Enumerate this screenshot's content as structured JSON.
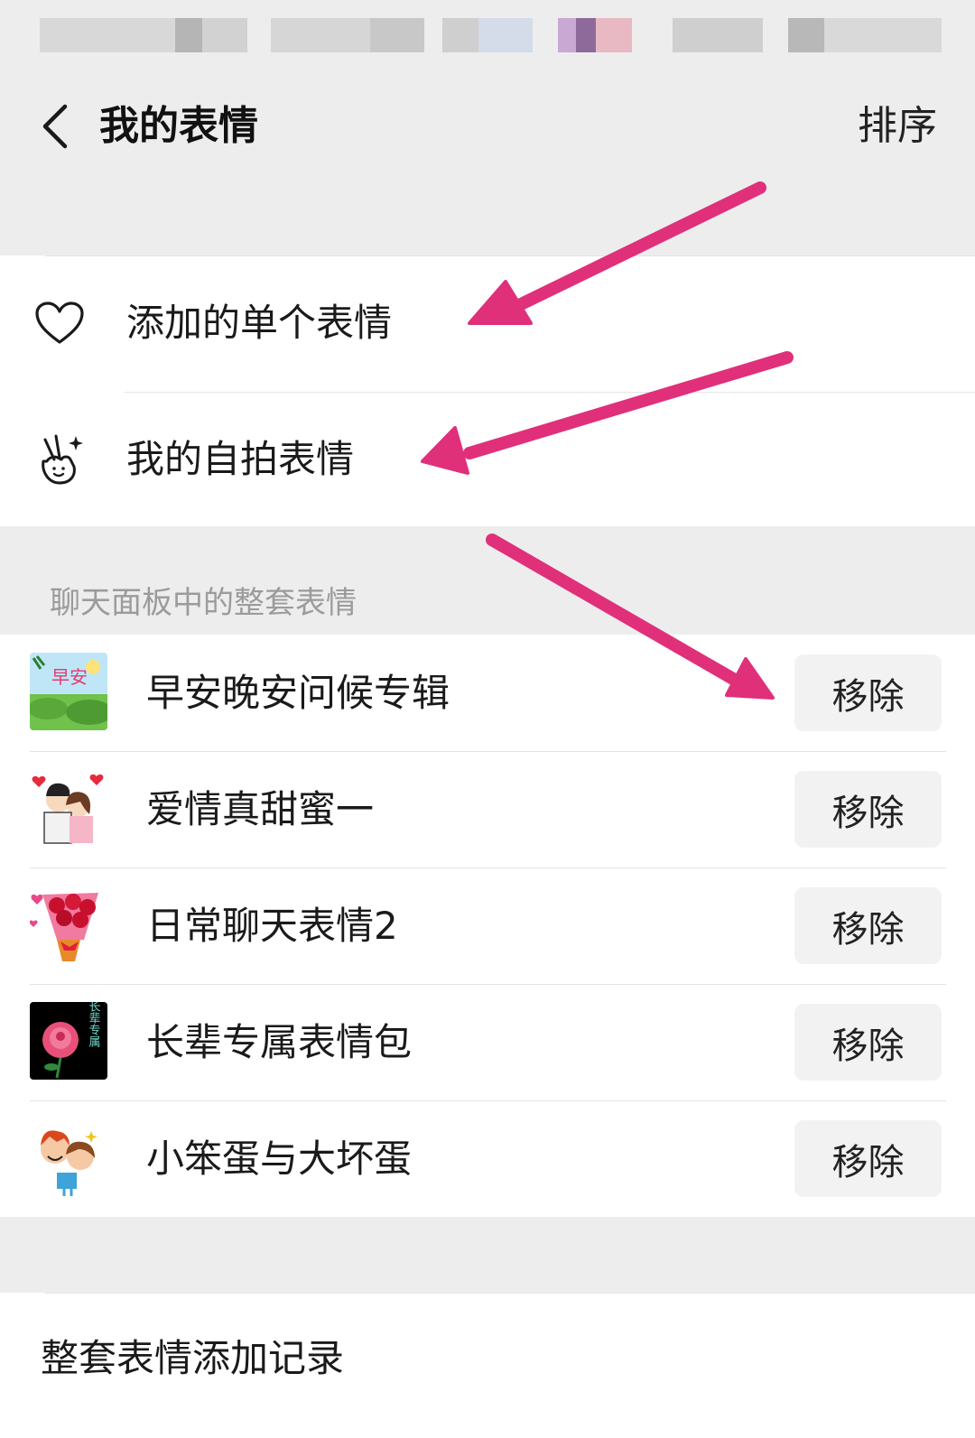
{
  "nav": {
    "title": "我的表情",
    "action": "排序"
  },
  "personal": {
    "items": [
      {
        "label": "添加的单个表情",
        "icon": "heart-icon"
      },
      {
        "label": "我的自拍表情",
        "icon": "victory-hand-icon"
      }
    ]
  },
  "sets": {
    "section_label": "聊天面板中的整套表情",
    "items": [
      {
        "name": "早安晚安问候专辑",
        "remove_label": "移除",
        "thumb_text": "早安"
      },
      {
        "name": "爱情真甜蜜一",
        "remove_label": "移除"
      },
      {
        "name": "日常聊天表情2",
        "remove_label": "移除"
      },
      {
        "name": "长辈专属表情包",
        "remove_label": "移除",
        "thumb_text": "长辈专属"
      },
      {
        "name": "小笨蛋与大坏蛋",
        "remove_label": "移除"
      }
    ]
  },
  "footer": {
    "history_label": "整套表情添加记录"
  },
  "colors": {
    "annotation_arrow": "#e0307a",
    "background": "#ededed",
    "panel": "#ffffff"
  }
}
